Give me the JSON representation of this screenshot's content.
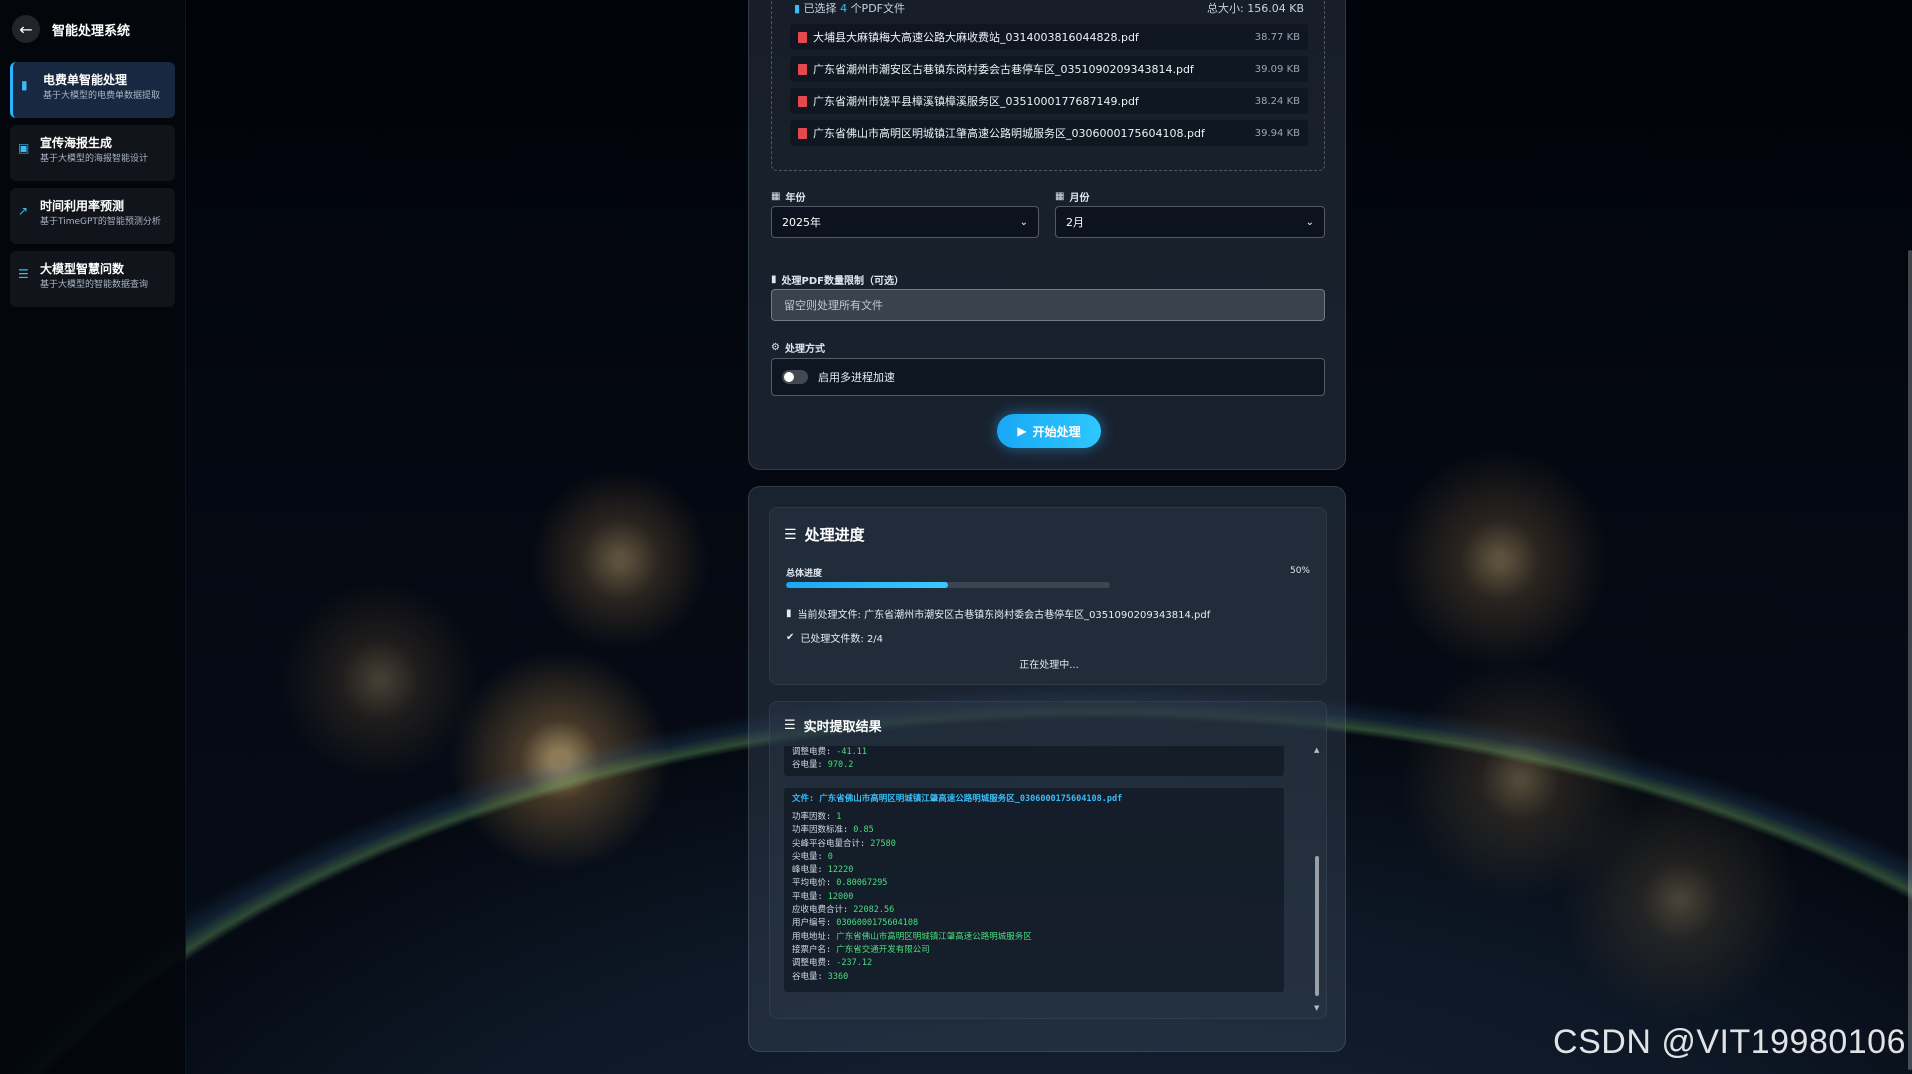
{
  "sidebar": {
    "title": "智能处理系统",
    "items": [
      {
        "label": "电费单智能处理",
        "sub": "基于大模型的电费单数据提取",
        "icon": "file-icon",
        "active": true
      },
      {
        "label": "宣传海报生成",
        "sub": "基于大模型的海报智能设计",
        "icon": "image-icon",
        "active": false
      },
      {
        "label": "时间利用率预测",
        "sub": "基于TimeGPT的智能预测分析",
        "icon": "chart-line-icon",
        "active": false
      },
      {
        "label": "大模型智慧问数",
        "sub": "基于大模型的智能数据查询",
        "icon": "database-icon",
        "active": false
      }
    ]
  },
  "files": {
    "summary_prefix": "已选择",
    "summary_count": "4",
    "summary_suffix": "个PDF文件",
    "total_size": "总大小: 156.04 KB",
    "list": [
      {
        "name": "大埔县大麻镇梅大高速公路大麻收费站_0314003816044828.pdf",
        "size": "38.77 KB"
      },
      {
        "name": "广东省潮州市潮安区古巷镇东岗村委会古巷停车区_0351090209343814.pdf",
        "size": "39.09 KB"
      },
      {
        "name": "广东省潮州市饶平县樟溪镇樟溪服务区_0351000177687149.pdf",
        "size": "38.24 KB"
      },
      {
        "name": "广东省佛山市高明区明城镇江肇高速公路明城服务区_0306000175604108.pdf",
        "size": "39.94 KB"
      }
    ]
  },
  "form": {
    "year_label": "年份",
    "year_value": "2025年",
    "month_label": "月份",
    "month_value": "2月",
    "limit_label": "处理PDF数量限制（可选）",
    "limit_placeholder": "留空则处理所有文件",
    "mode_label": "处理方式",
    "toggle_label": "启用多进程加速",
    "start_button": "开始处理"
  },
  "progress": {
    "title": "处理进度",
    "overall_label": "总体进度",
    "percent_text": "50%",
    "percent": 50,
    "current_file": "当前处理文件: 广东省潮州市潮安区古巷镇东岗村委会古巷停车区_0351090209343814.pdf",
    "processed": "已处理文件数: 2/4",
    "status": "正在处理中..."
  },
  "results": {
    "title": "实时提取结果",
    "prev_block": [
      {
        "k": "调整电费: ",
        "v": "-41.11"
      },
      {
        "k": "谷电量: ",
        "v": "970.2"
      }
    ],
    "block_title": "文件: 广东省佛山市高明区明城镇江肇高速公路明城服务区_0306000175604108.pdf",
    "block": [
      {
        "k": "功率因数: ",
        "v": "1"
      },
      {
        "k": "功率因数标准: ",
        "v": "0.85"
      },
      {
        "k": "尖峰平谷电量合计: ",
        "v": "27580"
      },
      {
        "k": "尖电量: ",
        "v": "0"
      },
      {
        "k": "峰电量: ",
        "v": "12220"
      },
      {
        "k": "平均电价: ",
        "v": "0.80067295"
      },
      {
        "k": "平电量: ",
        "v": "12000"
      },
      {
        "k": "应收电费合计: ",
        "v": "22082.56"
      },
      {
        "k": "用户编号: ",
        "v": "0306000175604108"
      },
      {
        "k": "用电地址: ",
        "v": "广东省佛山市高明区明城镇江肇高速公路明城服务区"
      },
      {
        "k": "接票户名: ",
        "v": "广东省交通开发有限公司"
      },
      {
        "k": "调整电费: ",
        "v": "-237.12"
      },
      {
        "k": "谷电量: ",
        "v": "3360"
      }
    ]
  },
  "watermark": "CSDN @VIT19980106"
}
